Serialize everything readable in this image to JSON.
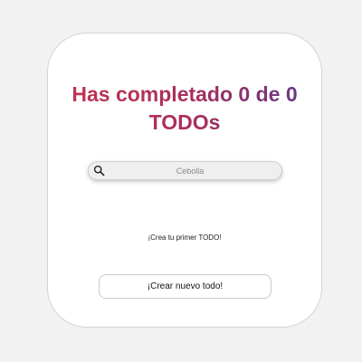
{
  "app": {
    "title_line1": "Has completado 0 de 0",
    "title_line2": "TODOs"
  },
  "search": {
    "placeholder": "Cebolla",
    "value": "",
    "icon": "search-icon"
  },
  "list": {
    "empty_message": "¡Crea tu primer TODO!"
  },
  "actions": {
    "create_label": "¡Crear nuevo todo!"
  },
  "colors": {
    "title_gradient_start": "#c4364f",
    "title_gradient_end": "#5b3a8e",
    "background": "#f2f2f2",
    "card": "#ffffff"
  }
}
